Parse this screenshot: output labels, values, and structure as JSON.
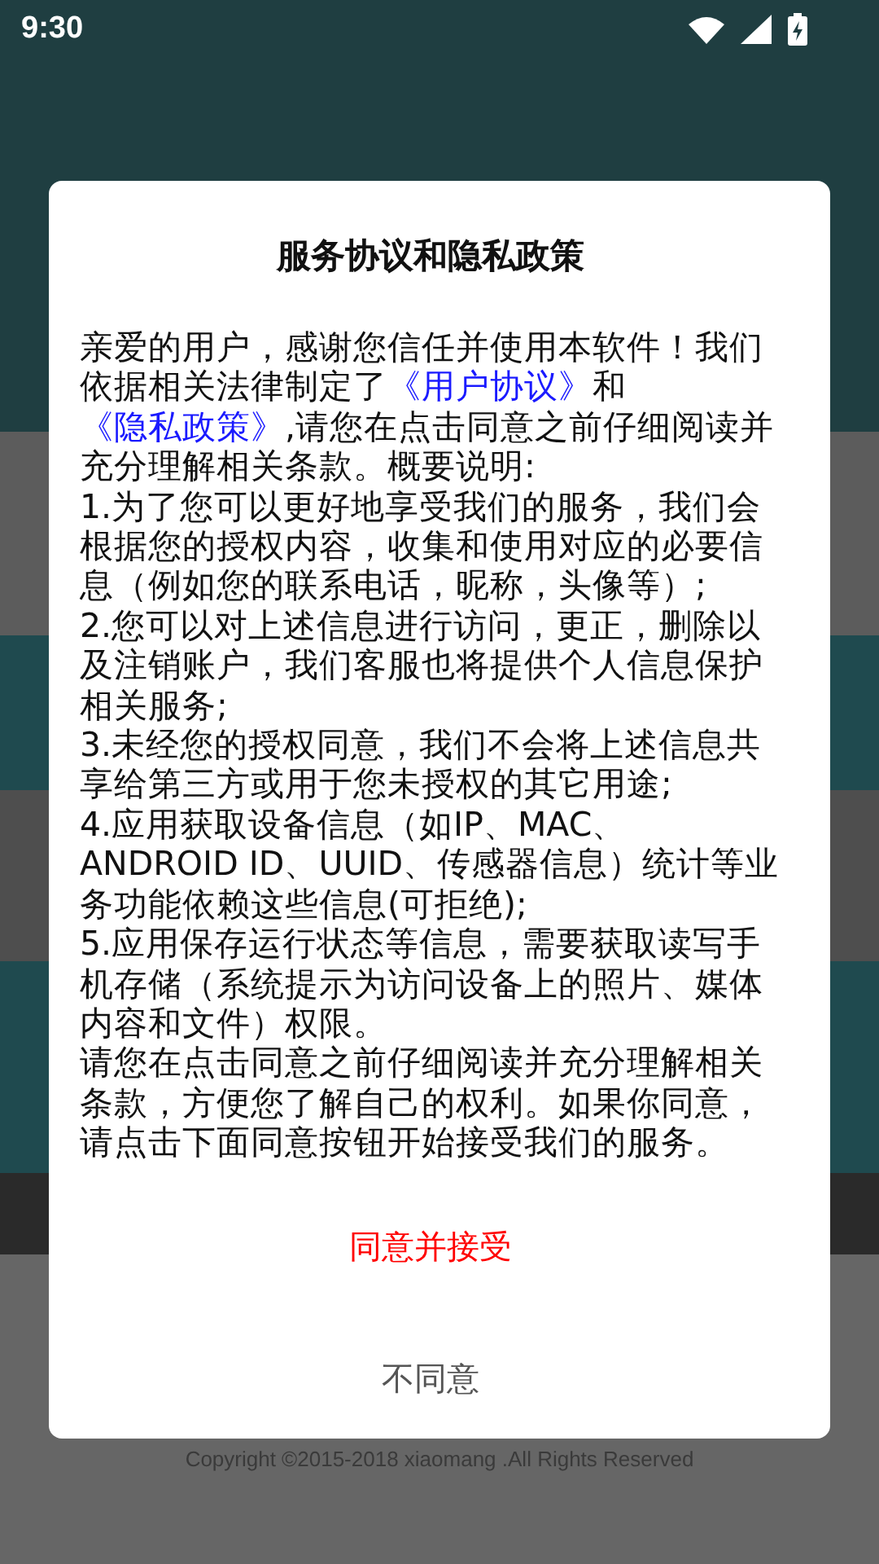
{
  "status_bar": {
    "time": "9:30"
  },
  "background": {
    "copyright": "Copyright ©2015-2018 xiaomang .All Rights Reserved"
  },
  "dialog": {
    "title": "服务协议和隐私政策",
    "intro": [
      {
        "kind": "text",
        "text": "亲爱的用户，感谢您信任并使用本软件！我们依据相关法律制定了"
      },
      {
        "kind": "link",
        "text": "《用户协议》"
      },
      {
        "kind": "text",
        "text": "和"
      },
      {
        "kind": "link",
        "text": "《隐私政策》"
      },
      {
        "kind": "text",
        "text": ",请您在点击同意之前仔细阅读并充分理解相关条款。概要说明:"
      }
    ],
    "paragraphs": [
      "1.为了您可以更好地享受我们的服务，我们会根据您的授权内容，收集和使用对应的必要信息（例如您的联系电话，昵称，头像等）;",
      "2.您可以对上述信息进行访问，更正，删除以及注销账户，我们客服也将提供个人信息保护相关服务;",
      "3.未经您的授权同意，我们不会将上述信息共享给第三方或用于您未授权的其它用途;",
      "4.应用获取设备信息（如IP、MAC、ANDROID ID、UUID、传感器信息）统计等业务功能依赖这些信息(可拒绝);",
      "5.应用保存运行状态等信息，需要获取读写手机存储（系统提示为访问设备上的照片、媒体内容和文件）权限。",
      "请您在点击同意之前仔细阅读并充分理解相关条款，方便您了解自己的权利。如果你同意，请点击下面同意按钮开始接受我们的服务。"
    ],
    "buttons": [
      {
        "kind": "primary",
        "label": "同意并接受"
      },
      {
        "kind": "secondary",
        "label": "不同意"
      }
    ]
  }
}
